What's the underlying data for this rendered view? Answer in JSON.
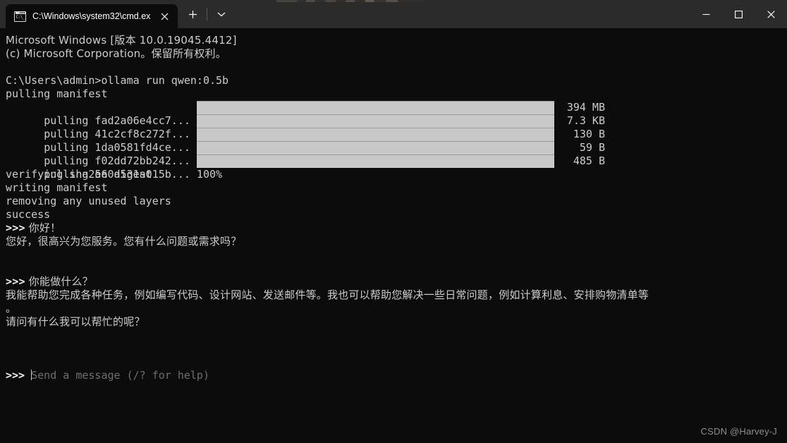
{
  "window": {
    "titlebar_color": "#2b2b2b",
    "terminal_bg": "#0c0c0c",
    "text_color": "#cccccc",
    "bar_color": "#c8c8c8"
  },
  "tab": {
    "title": "C:\\Windows\\system32\\cmd.ex",
    "icon": "cmd-console-icon",
    "close_icon": "close-icon",
    "new_tab_icon": "plus-icon",
    "tab_menu_icon": "chevron-down-icon"
  },
  "window_controls": {
    "minimize": "minimize-icon",
    "maximize": "maximize-icon",
    "close": "close-icon"
  },
  "terminal": {
    "banner": [
      "Microsoft Windows [版本 10.0.19045.4412]",
      "(c) Microsoft Corporation。保留所有权利。"
    ],
    "command_line": "C:\\Users\\admin>ollama run qwen:0.5b",
    "pulling_manifest": "pulling manifest",
    "layers": [
      {
        "label": "pulling fad2a06e4cc7... 100%",
        "percent": 100,
        "size": "394 MB"
      },
      {
        "label": "pulling 41c2cf8c272f... 100%",
        "percent": 100,
        "size": "7.3 KB"
      },
      {
        "label": "pulling 1da0581fd4ce... 100%",
        "percent": 100,
        "size": "130 B"
      },
      {
        "label": "pulling f02dd72bb242... 100%",
        "percent": 100,
        "size": "59 B"
      },
      {
        "label": "pulling ea0a531a015b... 100%",
        "percent": 100,
        "size": "485 B"
      }
    ],
    "post_pull": [
      "verifying sha256 digest",
      "writing manifest",
      "removing any unused layers",
      "success"
    ],
    "conversation": [
      {
        "prompt": ">>>",
        "user": " 你好！"
      },
      {
        "assistant": "您好，很高兴为您服务。您有什么问题或需求吗？"
      },
      {
        "prompt": ">>>",
        "user": " 你能做什么？"
      },
      {
        "assistant_wrap1": "我能帮助您完成各种任务，例如编写代码、设计网站、发送邮件等。我也可以帮助您解决一些日常问题，例如计算利息、安排购物清单等"
      },
      {
        "assistant_wrap2": "。"
      },
      {
        "assistant2": "请问有什么我可以帮忙的呢？"
      }
    ],
    "input_prompt": ">>>",
    "input_placeholder": "Send a message (/? for help)"
  },
  "watermark": "CSDN @Harvey-J"
}
